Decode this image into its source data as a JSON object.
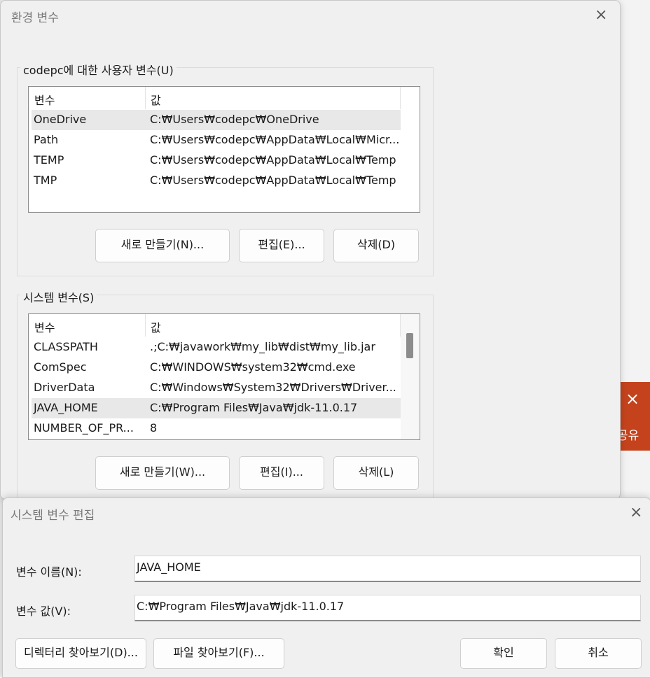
{
  "background": {
    "close_glyph": "×",
    "share_text": "공유",
    "accent_color": "#c4431d"
  },
  "env_dialog": {
    "title": "환경 변수",
    "close_glyph": "×",
    "user_group": {
      "label": "codepc에 대한 사용자 변수(U)",
      "headers": {
        "name": "변수",
        "value": "값"
      },
      "rows": [
        {
          "name": "OneDrive",
          "value": "C:₩Users₩codepc₩OneDrive"
        },
        {
          "name": "Path",
          "value": "C:₩Users₩codepc₩AppData₩Local₩Micr..."
        },
        {
          "name": "TEMP",
          "value": "C:₩Users₩codepc₩AppData₩Local₩Temp"
        },
        {
          "name": "TMP",
          "value": "C:₩Users₩codepc₩AppData₩Local₩Temp"
        }
      ],
      "buttons": {
        "new": "새로 만들기(N)...",
        "edit": "편집(E)...",
        "delete": "삭제(D)"
      }
    },
    "system_group": {
      "label": "시스템 변수(S)",
      "headers": {
        "name": "변수",
        "value": "값"
      },
      "rows": [
        {
          "name": "CLASSPATH",
          "value": ".;C:₩javawork₩my_lib₩dist₩my_lib.jar"
        },
        {
          "name": "ComSpec",
          "value": "C:₩WINDOWS₩system32₩cmd.exe"
        },
        {
          "name": "DriverData",
          "value": "C:₩Windows₩System32₩Drivers₩Driver..."
        },
        {
          "name": "JAVA_HOME",
          "value": "C:₩Program Files₩Java₩jdk-11.0.17"
        },
        {
          "name": "NUMBER_OF_PR...",
          "value": "8"
        }
      ],
      "buttons": {
        "new": "새로 만들기(W)...",
        "edit": "편집(I)...",
        "delete": "삭제(L)"
      }
    }
  },
  "edit_dialog": {
    "title": "시스템 변수 편집",
    "close_glyph": "×",
    "name_label": "변수 이름(N):",
    "name_value": "JAVA_HOME",
    "value_label": "변수 값(V):",
    "value_value": "C:₩Program Files₩Java₩jdk-11.0.17",
    "buttons": {
      "browse_dir": "디렉터리 찾아보기(D)...",
      "browse_file": "파일 찾아보기(F)...",
      "ok": "확인",
      "cancel": "취소"
    }
  }
}
